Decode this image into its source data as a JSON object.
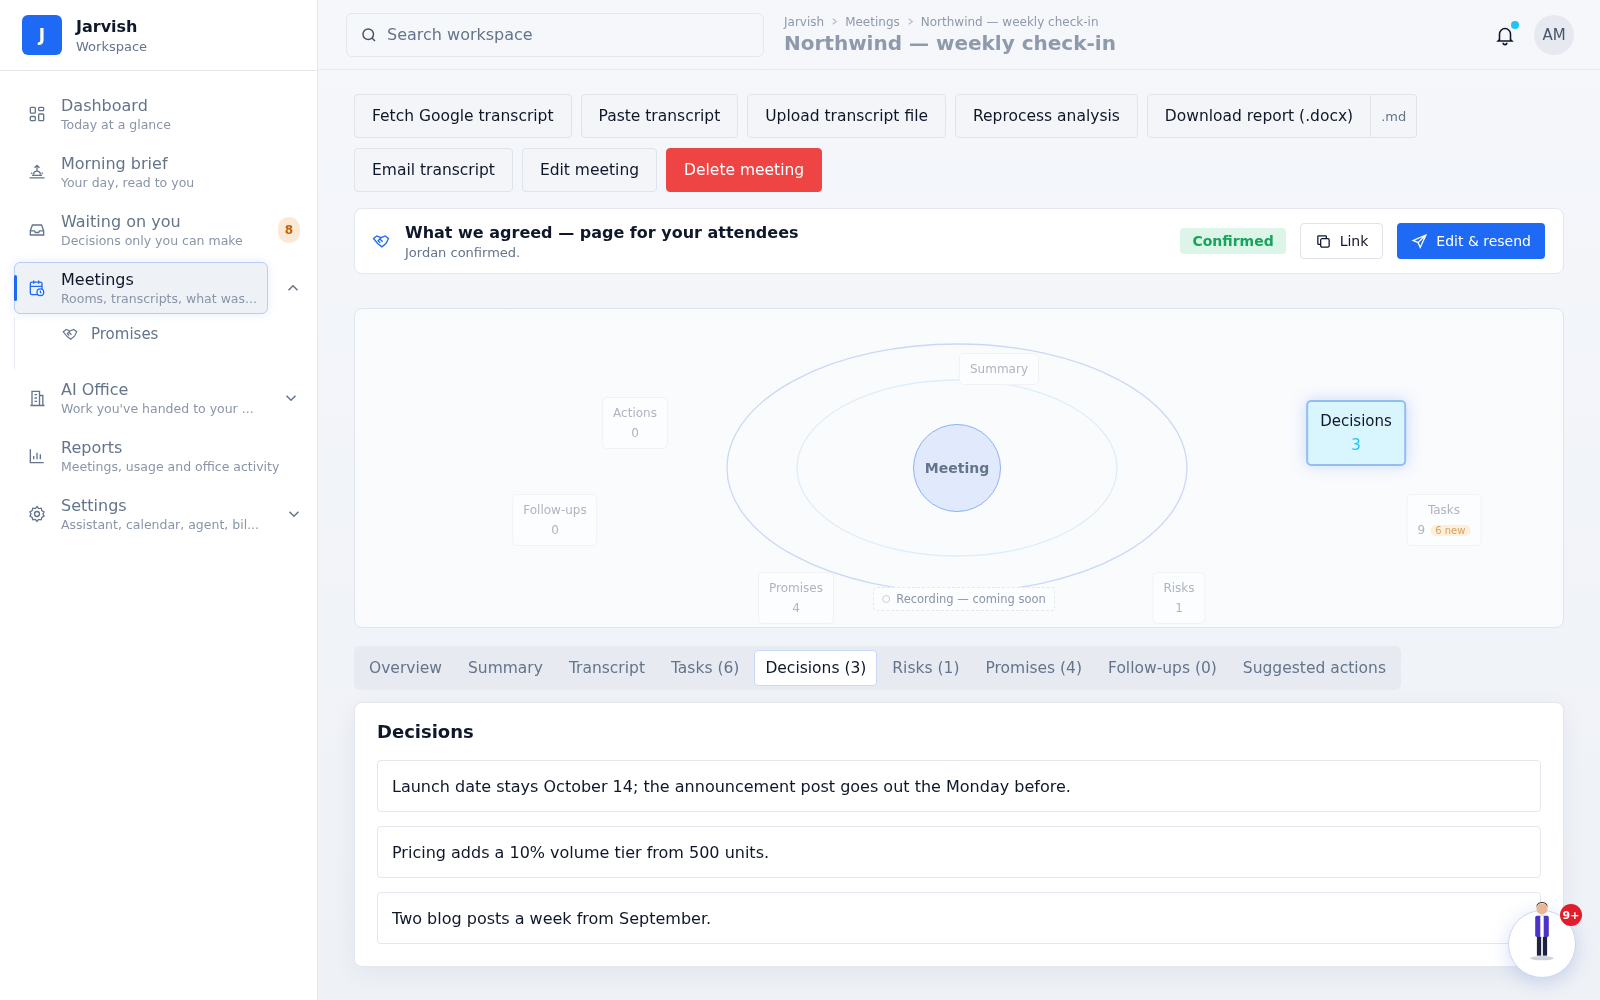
{
  "brand": {
    "initial": "J",
    "name": "Jarvish",
    "subtitle": "Workspace"
  },
  "nav": [
    {
      "title": "Dashboard",
      "subtitle": "Today at a glance",
      "selected": false
    },
    {
      "title": "Morning brief",
      "subtitle": "Your day, read to you",
      "selected": false
    },
    {
      "title": "Waiting on you",
      "subtitle": "Decisions only you can make",
      "selected": false,
      "badge": "8"
    },
    {
      "title": "Meetings",
      "subtitle": "Rooms, transcripts, what was...",
      "selected": true,
      "expanded": true,
      "children": [
        {
          "title": "Promises",
          "selected": false
        }
      ]
    },
    {
      "title": "AI Office",
      "subtitle": "Work you've handed to your ...",
      "selected": false,
      "expanded": false
    },
    {
      "title": "Reports",
      "subtitle": "Meetings, usage and office activity",
      "selected": false
    },
    {
      "title": "Settings",
      "subtitle": "Assistant, calendar, agent, bil...",
      "selected": false,
      "expanded": false
    }
  ],
  "header": {
    "breadcrumb": [
      "Jarvish",
      "Meetings",
      "Northwind — weekly check-in"
    ],
    "title": "Northwind — weekly check-in",
    "search": {
      "placeholder": "Search workspace"
    },
    "notifications_unread": true,
    "avatar": "AM"
  },
  "actions": [
    {
      "label": "Fetch Google transcript",
      "kind": "plain"
    },
    {
      "label": "Paste transcript",
      "kind": "plain"
    },
    {
      "label": "Upload transcript file",
      "kind": "plain"
    },
    {
      "label": "Reprocess analysis",
      "kind": "plain"
    },
    {
      "label": "Download report (.docx)",
      "kind": "split",
      "extra": ".md"
    },
    {
      "label": "Email transcript",
      "kind": "plain"
    },
    {
      "label": "Edit meeting",
      "kind": "plain"
    },
    {
      "label": "Delete meeting",
      "kind": "danger"
    }
  ],
  "agreed": {
    "title": "What we agreed — page for your attendees",
    "subtitle": "Jordan confirmed.",
    "status": "Confirmed",
    "link": "Link",
    "resend": "Edit & resend"
  },
  "map": {
    "center": "Meeting",
    "recording": "Recording — coming soon",
    "nodes": [
      {
        "label": "Summary",
        "selected": false
      },
      {
        "label": "Actions",
        "count": "0",
        "selected": false
      },
      {
        "label": "Follow-ups",
        "count": "0",
        "selected": false
      },
      {
        "label": "Decisions",
        "count": "3",
        "selected": true
      },
      {
        "label": "Tasks",
        "count": "9",
        "badge": "6 new",
        "selected": false
      },
      {
        "label": "Promises",
        "count": "4",
        "selected": false
      },
      {
        "label": "Risks",
        "count": "1",
        "selected": false
      }
    ]
  },
  "tabs": [
    {
      "label": "Overview",
      "selected": false
    },
    {
      "label": "Summary",
      "selected": false
    },
    {
      "label": "Transcript",
      "selected": false
    },
    {
      "label": "Tasks (6)",
      "selected": false
    },
    {
      "label": "Decisions (3)",
      "selected": true
    },
    {
      "label": "Risks (1)",
      "selected": false
    },
    {
      "label": "Promises (4)",
      "selected": false
    },
    {
      "label": "Follow-ups (0)",
      "selected": false
    },
    {
      "label": "Suggested actions",
      "selected": false
    }
  ],
  "panel": {
    "title": "Decisions",
    "items": [
      "Launch date stays October 14; the announcement post goes out the Monday before.",
      "Pricing adds a 10% volume tier from 500 units.",
      "Two blog posts a week from September."
    ]
  },
  "assistant": {
    "badge": "9+"
  }
}
